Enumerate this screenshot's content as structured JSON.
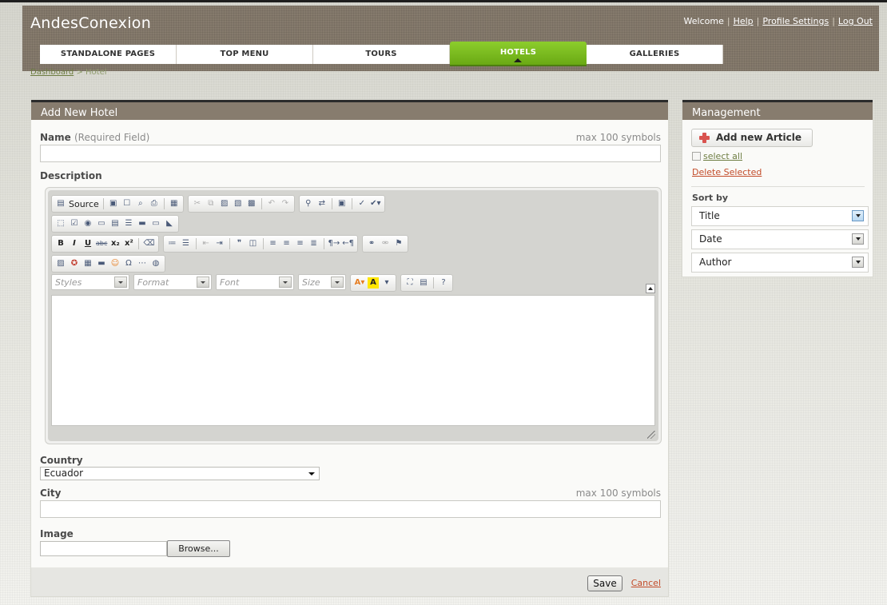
{
  "app": {
    "title": "AndesConexion",
    "top_links": {
      "welcome": "Welcome",
      "help": "Help",
      "profile": "Profile Settings",
      "logout": "Log Out"
    }
  },
  "nav": {
    "tabs": [
      {
        "label": "STANDALONE PAGES",
        "active": false
      },
      {
        "label": "TOP MENU",
        "active": false
      },
      {
        "label": "TOURS",
        "active": false
      },
      {
        "label": "HOTELS",
        "active": true
      },
      {
        "label": "GALLERIES",
        "active": false
      }
    ]
  },
  "breadcrumb": {
    "root": "Dashboard",
    "separator": ">",
    "current": "Hotel"
  },
  "form": {
    "title": "Add New Hotel",
    "name": {
      "label": "Name",
      "hint": "(Required Field)",
      "max_hint": "max 100 symbols",
      "value": ""
    },
    "description": {
      "label": "Description",
      "editor": {
        "source_label": "Source",
        "combos": {
          "styles": "Styles",
          "format": "Format",
          "font": "Font",
          "size": "Size"
        },
        "content": ""
      }
    },
    "country": {
      "label": "Country",
      "selected": "Ecuador"
    },
    "city": {
      "label": "City",
      "max_hint": "max 100 symbols",
      "value": ""
    },
    "image": {
      "label": "Image",
      "browse_label": "Browse..."
    },
    "actions": {
      "save": "Save",
      "cancel": "Cancel"
    }
  },
  "management": {
    "title": "Management",
    "add_button": "Add new Article",
    "select_all": "select all",
    "delete_selected": "Delete Selected",
    "sort_by_label": "Sort by",
    "sort_options": [
      "Title",
      "Date",
      "Author"
    ]
  },
  "colors": {
    "header_bg": "#857a6c",
    "active_tab": "#7cbd1f",
    "link_red": "#c34c2a",
    "link_green": "#6e7d42"
  }
}
